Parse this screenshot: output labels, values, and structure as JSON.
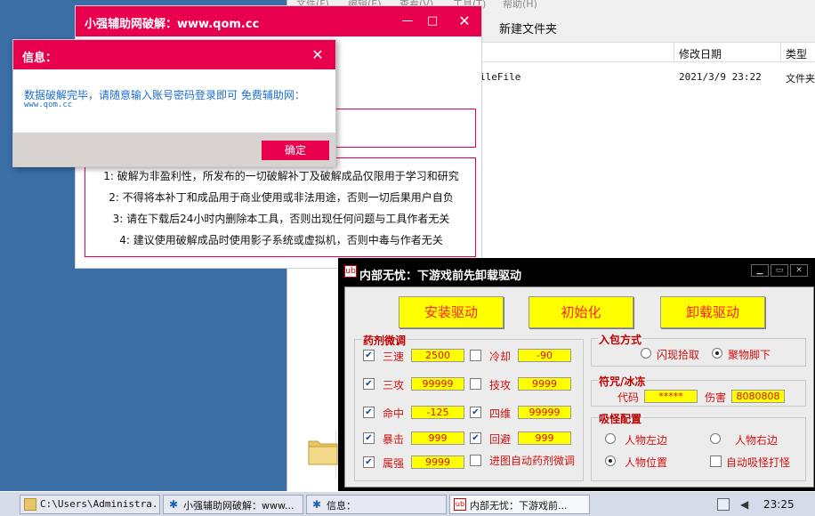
{
  "explorer": {
    "menu": [
      "文件(F)",
      "编辑(E)",
      "查看(V)",
      "工具(T)",
      "帮助(H)"
    ],
    "new_folder": "新建文件夹",
    "columns": {
      "modified": "修改日期",
      "type": "类型"
    },
    "row": {
      "name": "ileFile",
      "modified": "2021/3/9 23:22",
      "type": "文件夹"
    }
  },
  "main_dialog": {
    "title": "小强辅助网破解：www.qom.cc",
    "notices": [
      "1: 破解为非盈利性，所发布的一切破解补丁及破解成品仅限用于学习和研究",
      "2: 不得将本补丁和成品用于商业使用或非法用途，否则一切后果用户自负",
      "3: 请在下载后24小时内删除本工具，否则出现任何问题与工具作者无关",
      "4: 建议使用破解成品时使用影子系统或虚拟机，否则中毒与作者无关"
    ]
  },
  "info_dialog": {
    "title": "信息：",
    "message": "数据破解完毕，请随意输入账号密码登录即可 免费辅助网：",
    "url": "www.qom.cc",
    "ok_label": "确定"
  },
  "tool": {
    "title": "内部无忧：下游戏前先卸载驱动",
    "icon_text": "ub",
    "buttons": {
      "install": "安装驱动",
      "init": "初始化",
      "uninstall": "卸载驱动"
    },
    "potion": {
      "title": "药剂微调",
      "rows": [
        {
          "left_label": "三速",
          "left_value": "2500",
          "left_checked": true,
          "right_label": "冷却",
          "right_value": "-90",
          "right_checked": false
        },
        {
          "left_label": "三攻",
          "left_value": "99999",
          "left_checked": true,
          "right_label": "技攻",
          "right_value": "9999",
          "right_checked": false
        },
        {
          "left_label": "命中",
          "left_value": "-125",
          "left_checked": true,
          "right_label": "四维",
          "right_value": "99999",
          "right_checked": true
        },
        {
          "left_label": "暴击",
          "left_value": "999",
          "left_checked": true,
          "right_label": "回避",
          "right_value": "999",
          "right_checked": true
        },
        {
          "left_label": "属强",
          "left_value": "9999",
          "left_checked": true,
          "right_label": "进图自动药剂微调",
          "right_checked": false
        }
      ]
    },
    "pickup": {
      "title": "入包方式",
      "option1": "闪现拾取",
      "option2": "聚物脚下",
      "selected": "option2"
    },
    "freeze": {
      "title": "符咒/冰冻",
      "code_label": "代码",
      "code_value": "*****",
      "damage_label": "伤害",
      "damage_value": "8080808"
    },
    "absorb": {
      "title": "吸怪配置",
      "option_left": "人物左边",
      "option_right": "人物右边",
      "option_pos": "人物位置",
      "auto_label": "自动吸怪打怪",
      "selected": "option_pos"
    }
  },
  "taskbar": {
    "tasks": [
      "C:\\Users\\Administra...",
      "小强辅助网破解：www...",
      "信息：",
      "内部无忧：下游戏前..."
    ],
    "time": "23:25"
  }
}
